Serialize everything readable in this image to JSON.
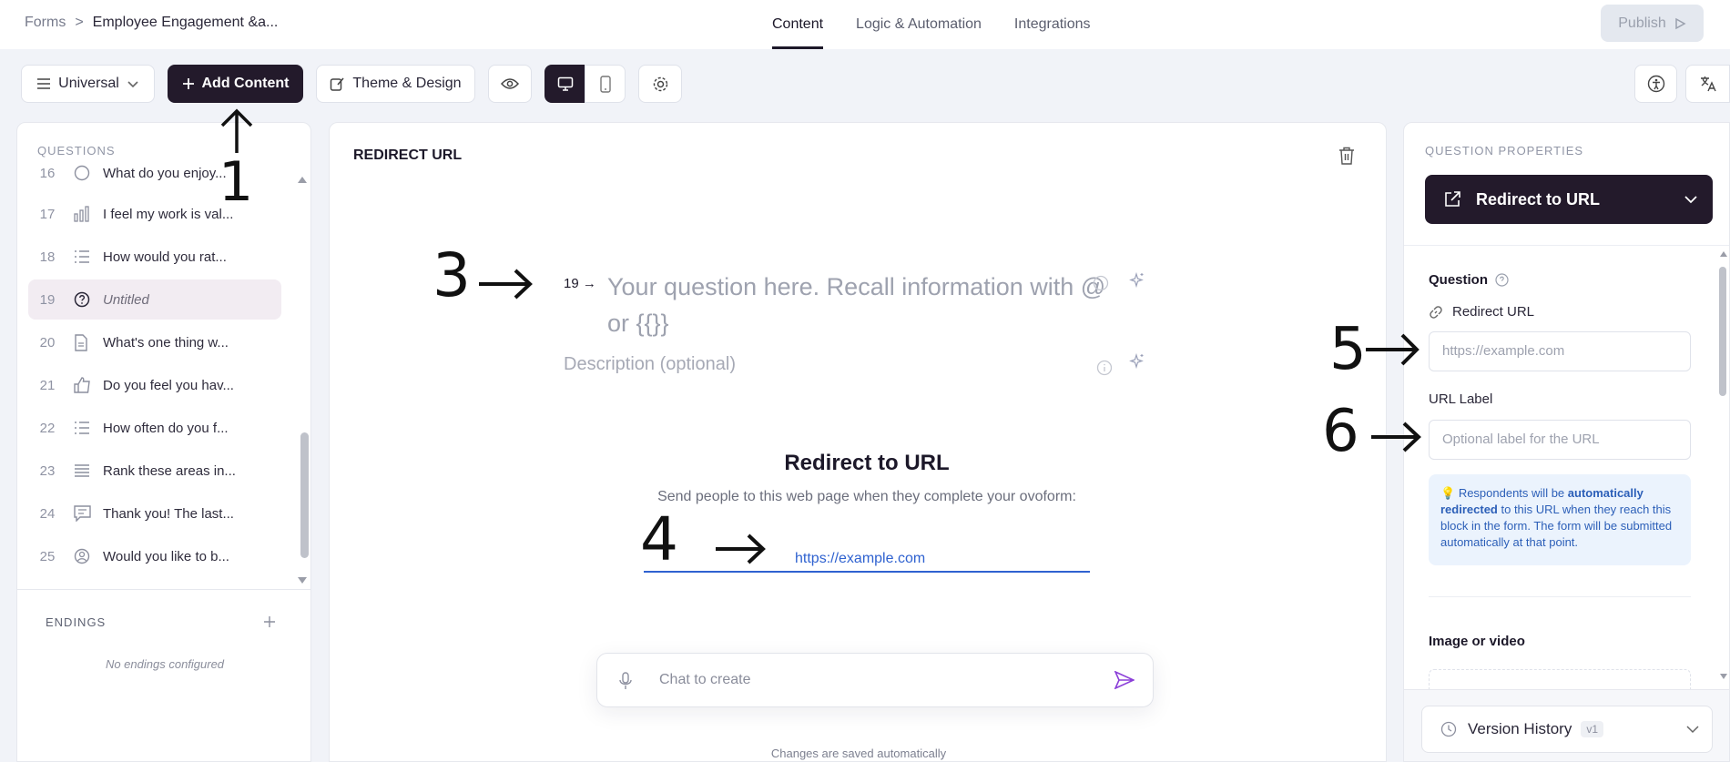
{
  "breadcrumb": {
    "root": "Forms",
    "separator": ">",
    "current": "Employee Engagement &a..."
  },
  "nav_tabs": [
    "Content",
    "Logic & Automation",
    "Integrations"
  ],
  "publish_label": "Publish",
  "toolbar": {
    "mode_label": "Universal",
    "add_content_label": "Add Content",
    "theme_label": "Theme & Design"
  },
  "questions_panel": {
    "title": "QUESTIONS",
    "items": [
      {
        "num": "16",
        "text": "What do you enjoy..."
      },
      {
        "num": "17",
        "text": "I feel my work is val..."
      },
      {
        "num": "18",
        "text": "How would you rat..."
      },
      {
        "num": "19",
        "text": "Untitled"
      },
      {
        "num": "20",
        "text": "What's one thing w..."
      },
      {
        "num": "21",
        "text": "Do you feel you hav..."
      },
      {
        "num": "22",
        "text": "How often do you f..."
      },
      {
        "num": "23",
        "text": "Rank these areas in..."
      },
      {
        "num": "24",
        "text": "Thank you! The last..."
      },
      {
        "num": "25",
        "text": "Would you like to b..."
      }
    ],
    "endings_title": "ENDINGS",
    "endings_empty": "No endings configured"
  },
  "canvas": {
    "block_title": "REDIRECT URL",
    "question_number": "19",
    "question_placeholder": "Your question here. Recall information with @ or {{}}",
    "description_placeholder": "Description (optional)",
    "redirect_title": "Redirect to URL",
    "redirect_subtitle": "Send people to this web page when they complete your ovoform:",
    "redirect_url": "https://example.com",
    "chat_placeholder": "Chat to create",
    "saved_note": "Changes are saved automatically"
  },
  "properties": {
    "title": "QUESTION PROPERTIES",
    "type_label": "Redirect to URL",
    "question_label": "Question",
    "redirect_url_label": "Redirect URL",
    "redirect_url_placeholder": "https://example.com",
    "url_label_label": "URL Label",
    "url_label_placeholder": "Optional label for the URL",
    "info_pre": "Respondents will be ",
    "info_bold": "automatically redirected",
    "info_post": " to this URL when they reach this block in the form. The form will be submitted automatically at that point.",
    "image_label": "Image or video",
    "version_label": "Version History",
    "version_badge": "v1"
  },
  "annotations": [
    "1",
    "3",
    "4",
    "5",
    "6"
  ],
  "colors": {
    "brand_dark": "#231a2b",
    "link_blue": "#2f62d0",
    "info_bg": "#ebf3fd",
    "accent_purple": "#8b3fd8"
  }
}
